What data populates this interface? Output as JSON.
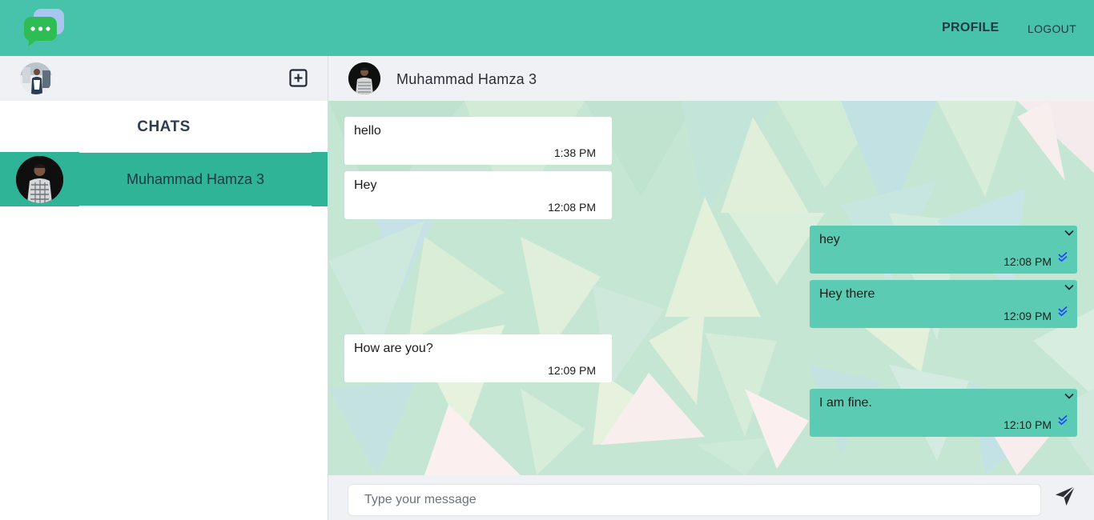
{
  "nav": {
    "profile_label": "PROFILE",
    "logout_label": "LOGOUT"
  },
  "colors": {
    "accent": "#47c3ab",
    "selected_chat": "#2fb497",
    "outgoing_bubble": "#5ccbb3",
    "read_ticks": "#1e40ff"
  },
  "sidebar": {
    "title": "CHATS",
    "chats": [
      {
        "name": "Muhammad Hamza 3",
        "selected": true
      }
    ]
  },
  "chat": {
    "contact_name": "Muhammad Hamza 3",
    "messages": [
      {
        "direction": "in",
        "text": "hello",
        "time": "1:38 PM"
      },
      {
        "direction": "in",
        "text": "Hey",
        "time": "12:08 PM"
      },
      {
        "direction": "out",
        "text": "hey",
        "time": "12:08 PM"
      },
      {
        "direction": "out",
        "text": "Hey there",
        "time": "12:09 PM"
      },
      {
        "direction": "in",
        "text": "How are you?",
        "time": "12:09 PM"
      },
      {
        "direction": "out",
        "text": "I am fine.",
        "time": "12:10 PM"
      }
    ],
    "composer": {
      "placeholder": "Type your message",
      "value": ""
    }
  },
  "icons": [
    "chat-bubbles-logo-icon",
    "plus-square-icon",
    "chevron-down-icon",
    "double-check-icon",
    "send-arrow-icon"
  ]
}
